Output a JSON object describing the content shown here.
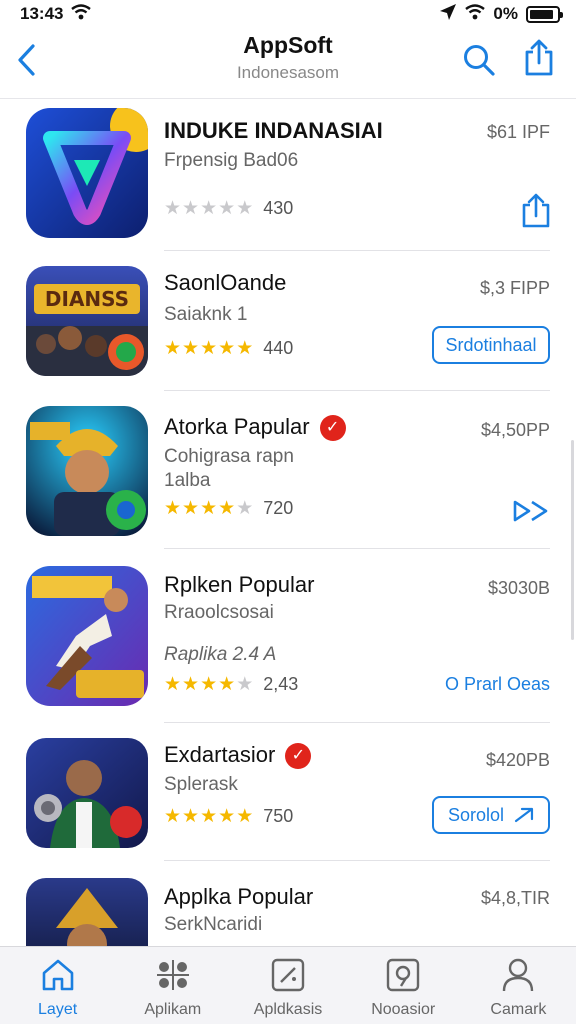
{
  "status_bar": {
    "time": "13:43",
    "battery_percent": "0%",
    "battery_level": 0.9
  },
  "header": {
    "title": "AppSoft",
    "subtitle": "Indonesasom"
  },
  "accent_color": "#1b7fe0",
  "apps": [
    {
      "name": "INDUKE INDANASIAI",
      "subtitle": "Frpensig Bad06",
      "subtitle2": "",
      "price": "$61 IPF",
      "stars": 0,
      "rating_count": "430",
      "verified": false,
      "action": {
        "type": "share-icon",
        "label": ""
      }
    },
    {
      "name": "SaonlOande",
      "subtitle": "Saiaknk 1",
      "subtitle2": "",
      "price": "$,3 FIPP",
      "stars": 4.5,
      "rating_count": "440",
      "verified": false,
      "action": {
        "type": "outline-button",
        "label": "Srdotinhaal"
      }
    },
    {
      "name": "Atorka Papular",
      "subtitle": "Cohigrasa rapn",
      "subtitle2": "1alba",
      "price": "$4,50PP",
      "stars": 3.5,
      "rating_count": "720",
      "verified": true,
      "action": {
        "type": "forward-icon",
        "label": ""
      }
    },
    {
      "name": "Rplken Popular",
      "subtitle": "Rraoolcsosai",
      "subtitle2": "Raplika 2.4 A",
      "price": "$3030B",
      "stars": 4,
      "rating_count": "2,43",
      "verified": false,
      "action": {
        "type": "link",
        "label": "O Prarl Oeas"
      }
    },
    {
      "name": "Exdartasior",
      "subtitle": "Splerask",
      "subtitle2": "",
      "price": "$420PB",
      "stars": 4.5,
      "rating_count": "750",
      "verified": true,
      "action": {
        "type": "outline-button-arrow",
        "label": "Sorolol"
      }
    },
    {
      "name": "Applka Popular",
      "subtitle": "SerkNcaridi",
      "subtitle2": "",
      "price": "$4,8,TIR",
      "stars": 0,
      "rating_count": "",
      "verified": false,
      "action": {
        "type": "none",
        "label": ""
      }
    }
  ],
  "tabs": [
    {
      "label": "Layet",
      "icon": "home-icon",
      "active": true
    },
    {
      "label": "Aplikam",
      "icon": "apps-grid-icon",
      "active": false
    },
    {
      "label": "Apldkasis",
      "icon": "games-icon",
      "active": false
    },
    {
      "label": "Nooasior",
      "icon": "search-tab-icon",
      "active": false
    },
    {
      "label": "Camark",
      "icon": "profile-icon",
      "active": false
    }
  ]
}
